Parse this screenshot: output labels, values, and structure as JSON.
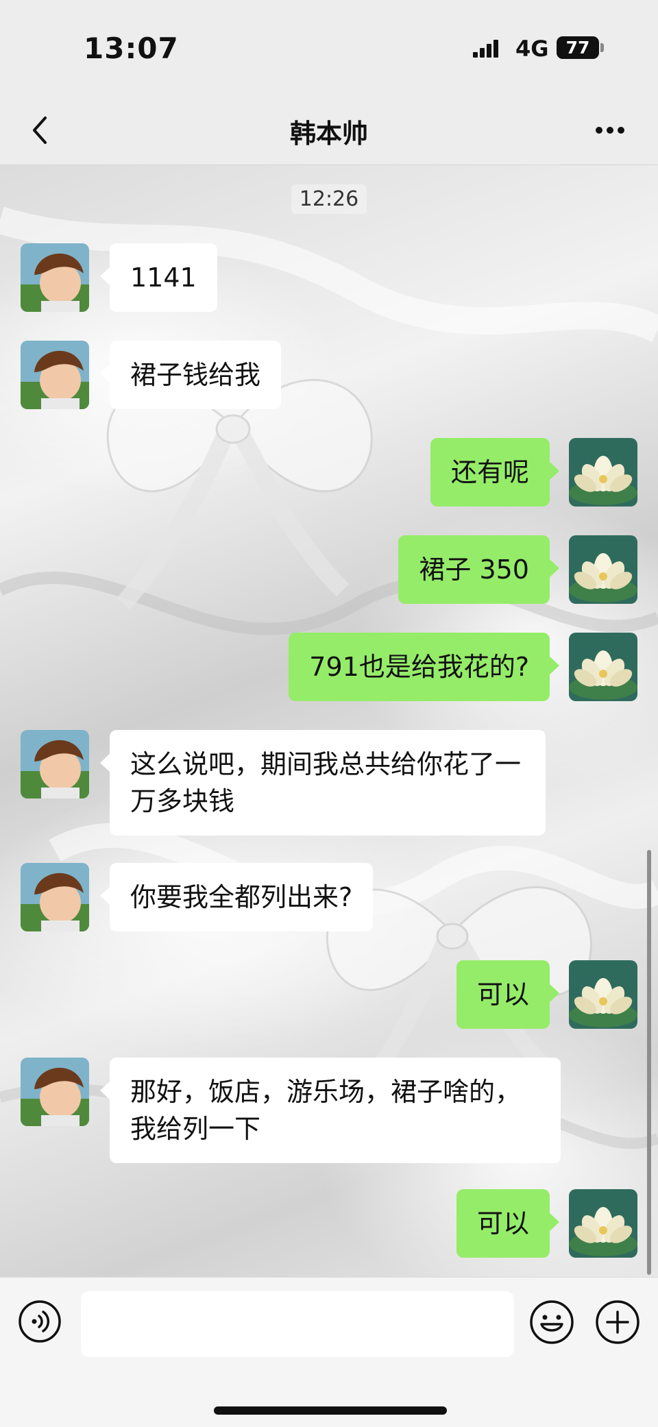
{
  "status_bar": {
    "time": "13:07",
    "network": "4G",
    "battery": "77"
  },
  "header": {
    "title": "韩本帅"
  },
  "chat": {
    "timestamp": "12:26",
    "messages": [
      {
        "side": "left",
        "text": "1141"
      },
      {
        "side": "left",
        "text": "裙子钱给我"
      },
      {
        "side": "right",
        "text": "还有呢"
      },
      {
        "side": "right",
        "text": "裙子 350"
      },
      {
        "side": "right",
        "text": "791也是给我花的?"
      },
      {
        "side": "left",
        "text": "这么说吧，期间我总共给你花了一万多块钱"
      },
      {
        "side": "left",
        "text": "你要我全都列出来?"
      },
      {
        "side": "right",
        "text": "可以"
      },
      {
        "side": "left",
        "text": "那好，饭店，游乐场，裙子啥的，我给列一下"
      },
      {
        "side": "right",
        "text": "可以"
      }
    ]
  },
  "input": {
    "value": "",
    "placeholder": ""
  },
  "colors": {
    "sent_bubble": "#95ec69",
    "received_bubble": "#ffffff",
    "bar_background": "#ededed"
  }
}
